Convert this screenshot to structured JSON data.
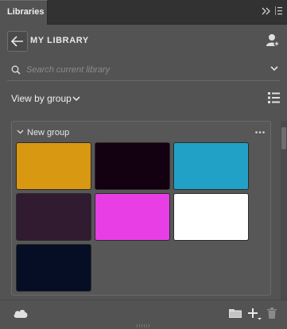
{
  "panel": {
    "tab_label": "Libraries"
  },
  "library": {
    "title": "MY LIBRARY"
  },
  "search": {
    "placeholder": "Search current library"
  },
  "view": {
    "label": "View by group"
  },
  "group": {
    "name": "New group",
    "swatches": [
      {
        "color": "#D99812"
      },
      {
        "color": "#130011"
      },
      {
        "color": "#22A1C6"
      },
      {
        "color": "#301B31"
      },
      {
        "color": "#E73EE6"
      },
      {
        "color": "#FFFFFF"
      },
      {
        "color": "#050E24"
      }
    ]
  },
  "icons": {
    "back": "arrow-left-icon",
    "user": "user-add-icon",
    "search": "search-icon",
    "view": "list-view-icon",
    "more": "more-icon",
    "cloud": "cloud-icon",
    "folder": "folder-icon",
    "add": "add-icon",
    "trash": "trash-icon"
  }
}
